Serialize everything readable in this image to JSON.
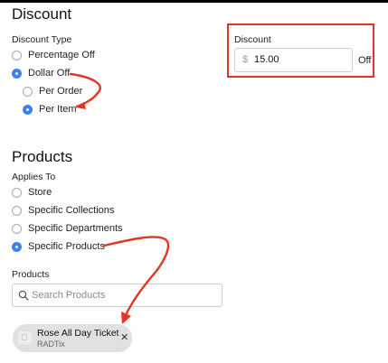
{
  "discount_section": {
    "title": "Discount",
    "type_label": "Discount Type",
    "type_options": [
      {
        "label": "Percentage Off",
        "selected": false
      },
      {
        "label": "Dollar Off",
        "selected": true
      }
    ],
    "dollar_sub_options": [
      {
        "label": "Per Order",
        "selected": false
      },
      {
        "label": "Per Item",
        "selected": true
      }
    ],
    "amount_label": "Discount",
    "currency_symbol": "$",
    "amount_value": "15.00",
    "amount_suffix": "Off"
  },
  "products_section": {
    "title": "Products",
    "applies_to_label": "Applies To",
    "applies_options": [
      {
        "label": "Store",
        "selected": false
      },
      {
        "label": "Specific Collections",
        "selected": false
      },
      {
        "label": "Specific Departments",
        "selected": false
      },
      {
        "label": "Specific Products",
        "selected": true
      }
    ],
    "products_label": "Products",
    "search_placeholder": "Search Products",
    "selected_product": {
      "name": "Rose All Day Ticket",
      "vendor": "RADTix"
    }
  },
  "colors": {
    "accent": "#3b82f6",
    "annotation": "#e53421"
  },
  "icons": [
    "search-icon",
    "close-icon",
    "product-thumbnail-icon"
  ]
}
